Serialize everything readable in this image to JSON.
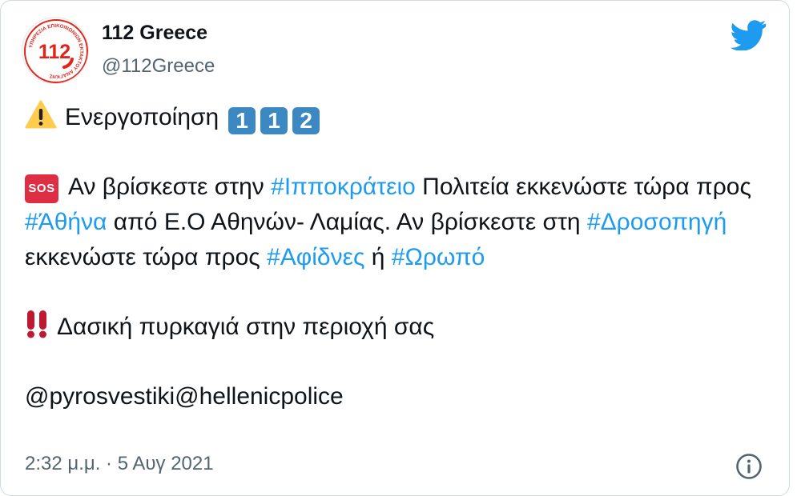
{
  "author": {
    "name": "112 Greece",
    "handle": "@112Greece",
    "avatar_text": "112",
    "avatar_ring_text": "ΥΠΗΡΕΣΙΑ ΕΠΙΚΟΙΝΩΝΙΩΝ ΕΚΤΑΚΤΟΥ ΑΝΑΓΚΗΣ"
  },
  "icons": {
    "platform_logo": "twitter-bird-icon",
    "warning": "warning-icon",
    "sos": "sos-icon",
    "double_exclamation": "double-exclamation-icon",
    "info": "info-icon"
  },
  "tweet": {
    "line1": {
      "text": "Ενεργοποίηση",
      "keycaps": [
        "1",
        "1",
        "2"
      ]
    },
    "line2": {
      "sos_label": "SOS",
      "t1": "Αν βρίσκεστε στην ",
      "h1": "#Ιπποκράτειο",
      "t2": " Πολιτεία εκκενώστε τώρα προς ",
      "h2": "#Άθήνα",
      "t3": " από Ε.Ο Αθηνών- Λαμίας. Αν βρίσκεστε στη ",
      "h3": "#Δροσοπηγή",
      "t4": " εκκενώστε τώρα προς ",
      "h4": "#Αφίδνες",
      "t5": " ή ",
      "h5": "#Ωρωπό"
    },
    "line3": {
      "text": "Δασική πυρκαγιά στην περιοχή σας"
    },
    "line4": {
      "text": "@pyrosvestiki@hellenicpolice"
    }
  },
  "footer": {
    "timestamp": "2:32 μ.μ. · 5 Αυγ 2021"
  },
  "colors": {
    "hashtag": "#1d9bf0",
    "twitter_blue": "#1d9bf0",
    "keycap": "#3b88c3",
    "sos": "#dd2e44",
    "avatar_red": "#e2231a",
    "muted_text": "#536471"
  }
}
